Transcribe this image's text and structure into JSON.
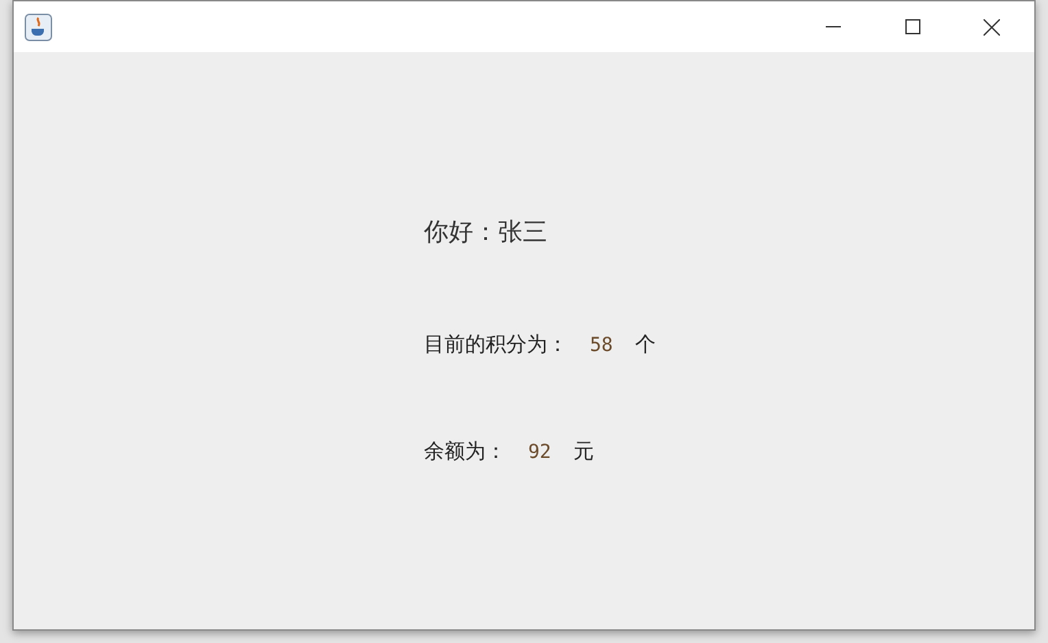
{
  "window": {
    "title_bar_buttons": [
      {
        "kind": "minimize"
      },
      {
        "kind": "maximize"
      },
      {
        "kind": "close"
      }
    ]
  },
  "greeting": {
    "label": "你好：",
    "name": "张三"
  },
  "points": {
    "label": "目前的积分为：",
    "value": "58",
    "unit": "个"
  },
  "balance": {
    "label": "余额为：",
    "value": "92",
    "unit": "元"
  }
}
